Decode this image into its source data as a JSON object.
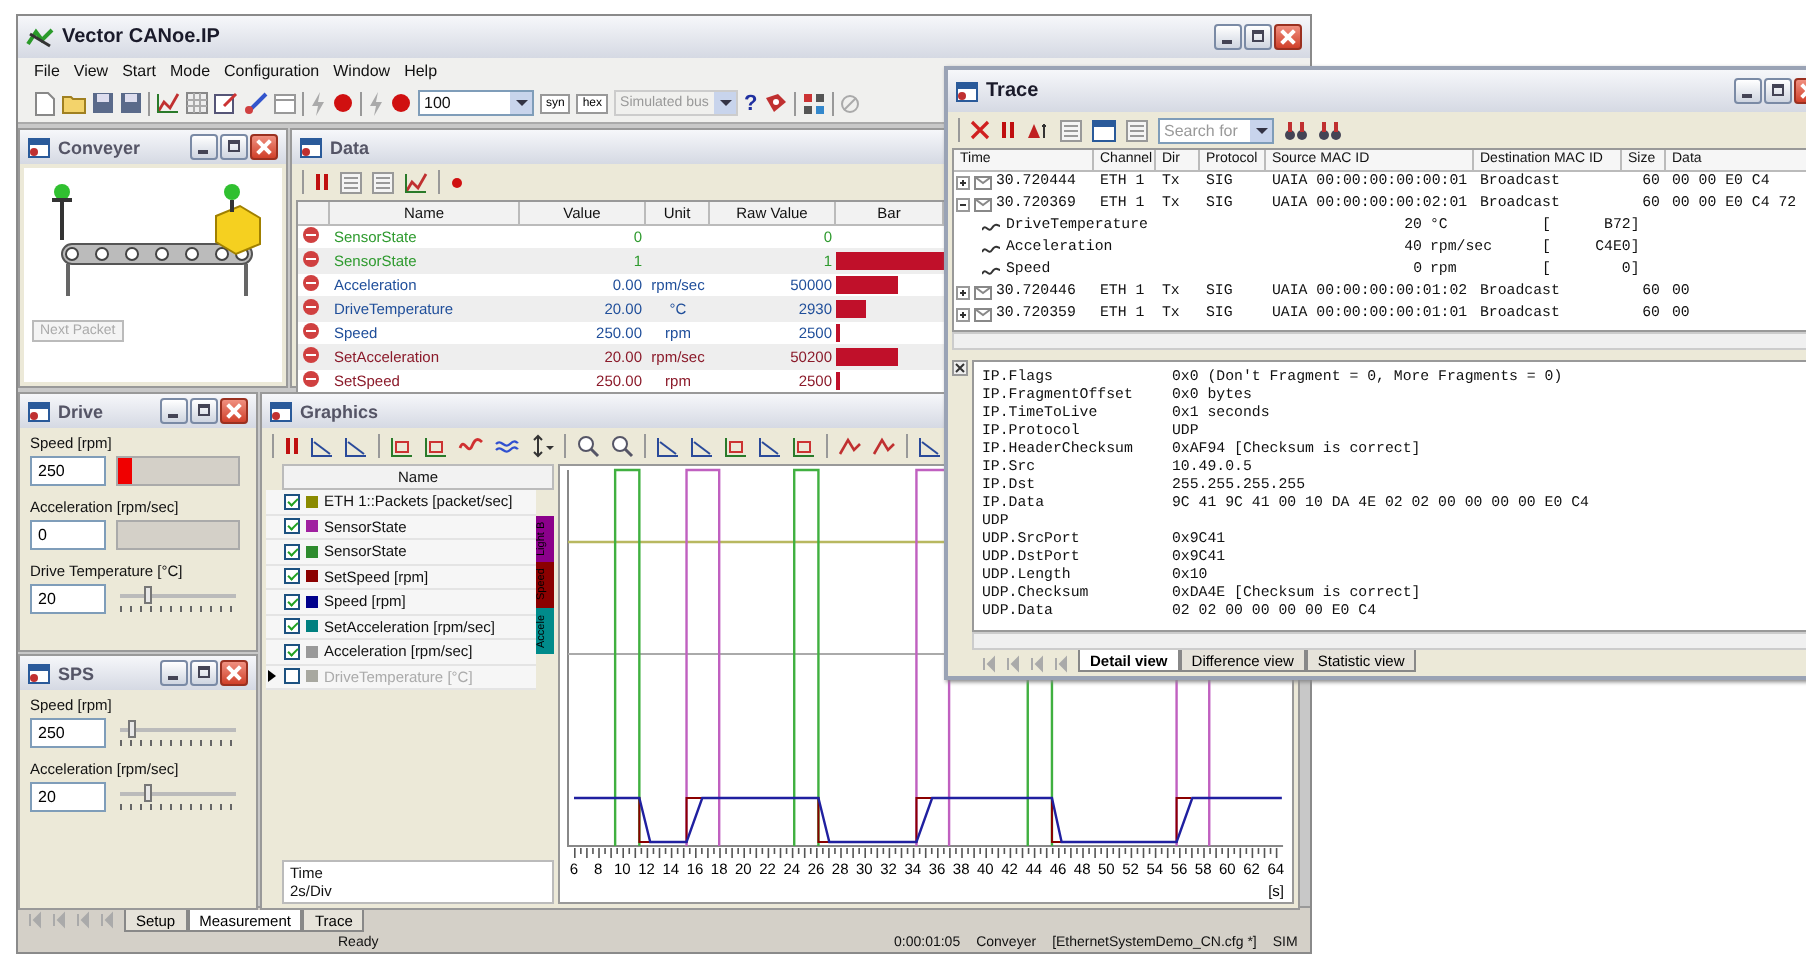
{
  "main_window": {
    "title": "Vector CANoe.IP",
    "menu": [
      "File",
      "View",
      "Start",
      "Mode",
      "Configuration",
      "Window",
      "Help"
    ],
    "toolbar": {
      "zoom_value": "100",
      "buttons": [
        "syn",
        "hex"
      ],
      "bus_select": {
        "value": "Simulated bus",
        "disabled": true
      },
      "help_button": "?"
    }
  },
  "conveyer": {
    "title": "Conveyer",
    "next_button": {
      "label": "Next Packet",
      "disabled": true
    }
  },
  "data": {
    "title": "Data",
    "columns": [
      "Name",
      "Value",
      "Unit",
      "Raw Value",
      "Bar"
    ],
    "rows": [
      {
        "name": "SensorState",
        "value": "0",
        "raw": "0",
        "level": 0,
        "color": "#2e9a2e"
      },
      {
        "name": "SensorState",
        "value": "1",
        "raw": "1",
        "level": 1,
        "color": "#2e9a2e"
      },
      {
        "name": "Acceleration",
        "value": "0.00",
        "unit": "rpm/sec",
        "raw": "50000",
        "level": 0.57,
        "color": "#1f4e9a"
      },
      {
        "name": "DriveTemperature",
        "value": "20.00",
        "unit": "°C",
        "raw": "2930",
        "level": 0.27,
        "color": "#1f4e9a"
      },
      {
        "name": "Speed",
        "value": "250.00",
        "unit": "rpm",
        "raw": "2500",
        "level": 0.04,
        "color": "#1f4e9a"
      },
      {
        "name": "SetAcceleration",
        "value": "20.00",
        "unit": "rpm/sec",
        "raw": "50200",
        "level": 0.57,
        "color": "#8b1a2a"
      },
      {
        "name": "SetSpeed",
        "value": "250.00",
        "unit": "rpm",
        "raw": "2500",
        "level": 0.04,
        "color": "#8b1a2a"
      }
    ]
  },
  "drive": {
    "title": "Drive",
    "controls": [
      {
        "kind": "bar",
        "label": "Speed [rpm]",
        "value": "250",
        "level": 0.12
      },
      {
        "kind": "bar",
        "label": "Acceleration [rpm/sec]",
        "value": "0",
        "level": 0
      },
      {
        "kind": "slider",
        "label": "Drive Temperature [°C]",
        "value": "20",
        "level": 0.25
      }
    ]
  },
  "sps": {
    "title": "SPS",
    "controls": [
      {
        "kind": "slider",
        "label": "Speed [rpm]",
        "value": "250",
        "level": 0.12
      },
      {
        "kind": "slider",
        "label": "Acceleration [rpm/sec]",
        "value": "20",
        "level": 0.25
      }
    ]
  },
  "graphics": {
    "title": "Graphics",
    "list_header": "Name",
    "signals": [
      {
        "name": "ETH 1::Packets [packet/sec]",
        "color": "#8a8a00",
        "checked": true
      },
      {
        "name": "SensorState",
        "color": "#a020a0",
        "checked": true
      },
      {
        "name": "SensorState",
        "color": "#2e8b2e",
        "checked": true
      },
      {
        "name": "SetSpeed [rpm]",
        "color": "#8b0000",
        "checked": true
      },
      {
        "name": "Speed [rpm]",
        "color": "#00008b",
        "checked": true
      },
      {
        "name": "SetAcceleration [rpm/sec]",
        "color": "#008080",
        "checked": true
      },
      {
        "name": "Acceleration [rpm/sec]",
        "color": "#999999",
        "checked": true
      },
      {
        "name": "DriveTemperature [°C]",
        "color": "#a8a8a0",
        "checked": false
      }
    ],
    "axis_tags": [
      {
        "label": "Light B",
        "color": "#8b008b"
      },
      {
        "label": "Speed",
        "color": "#8b0000"
      },
      {
        "label": "Accele",
        "color": "#008b8b"
      }
    ],
    "time_label": "Time",
    "time_div": "2s/Div",
    "x_ticks": [
      "6",
      "8",
      "10",
      "12",
      "14",
      "16",
      "18",
      "20",
      "22",
      "24",
      "26",
      "28",
      "30",
      "32",
      "34",
      "36",
      "38",
      "40",
      "42",
      "44",
      "46",
      "48",
      "50",
      "52",
      "54",
      "56",
      "58",
      "60",
      "62",
      "64"
    ],
    "x_unit": "[s]"
  },
  "page_tabs": [
    {
      "label": "Setup",
      "selected": false
    },
    {
      "label": "Measurement",
      "selected": true
    },
    {
      "label": "Trace",
      "selected": false
    }
  ],
  "status_bar": [
    "Ready",
    "0:00:01:05",
    "Conveyer",
    "[EthernetSystemDemo_CN.cfg *]",
    "SIM"
  ],
  "trace": {
    "title": "Trace",
    "search": {
      "placeholder": "Search for"
    },
    "columns": [
      "Time",
      "Channel",
      "Dir",
      "Protocol",
      "Source MAC ID",
      "Destination MAC ID",
      "Size",
      "Data"
    ],
    "rows": [
      {
        "time": "30.720444",
        "channel": "ETH 1",
        "dir": "Tx",
        "protocol": "SIG",
        "source": "UAIA 00:00:00:00:00:01",
        "destination": "Broadcast",
        "size": "60",
        "data": "00 00 E0 C4",
        "expanded": false
      },
      {
        "time": "30.720369",
        "channel": "ETH 1",
        "dir": "Tx",
        "protocol": "SIG",
        "source": "UAIA 00:00:00:00:02:01",
        "destination": "Broadcast",
        "size": "60",
        "data": "00 00 E0 C4 72",
        "expanded": true,
        "children": [
          {
            "name": "DriveTemperature",
            "value": "20",
            "unit": "°C",
            "raw": "[      B72]"
          },
          {
            "name": "Acceleration",
            "value": "40",
            "unit": "rpm/sec",
            "raw": "[     C4E0]"
          },
          {
            "name": "Speed",
            "value": "0",
            "unit": "rpm",
            "raw": "[        0]"
          }
        ]
      },
      {
        "time": "30.720446",
        "channel": "ETH 1",
        "dir": "Tx",
        "protocol": "SIG",
        "source": "UAIA 00:00:00:00:01:02",
        "destination": "Broadcast",
        "size": "60",
        "data": "00",
        "expanded": false
      },
      {
        "time": "30.720359",
        "channel": "ETH 1",
        "dir": "Tx",
        "protocol": "SIG",
        "source": "UAIA 00:00:00:00:01:01",
        "destination": "Broadcast",
        "size": "60",
        "data": "00",
        "expanded": false
      }
    ],
    "detail": [
      {
        "key": "IP.Flags",
        "value": "0x0 (Don't Fragment = 0, More Fragments = 0)"
      },
      {
        "key": "IP.FragmentOffset",
        "value": "0x0 bytes"
      },
      {
        "key": "IP.TimeToLive",
        "value": "0x1 seconds"
      },
      {
        "key": "IP.Protocol",
        "value": "UDP"
      },
      {
        "key": "IP.HeaderChecksum",
        "value": "0xAF94 [Checksum is correct]"
      },
      {
        "key": "IP.Src",
        "value": "10.49.0.5"
      },
      {
        "key": "IP.Dst",
        "value": "255.255.255.255"
      },
      {
        "key": "IP.Data",
        "value": "9C 41 9C 41 00 10 DA 4E 02 02 00 00 00 00 E0 C4"
      },
      {
        "key": "UDP"
      },
      {
        "key": "UDP.SrcPort",
        "value": "0x9C41"
      },
      {
        "key": "UDP.DstPort",
        "value": "0x9C41"
      },
      {
        "key": "UDP.Length",
        "value": "0x10"
      },
      {
        "key": "UDP.Checksum",
        "value": "0xDA4E [Checksum is correct]"
      },
      {
        "key": "UDP.Data",
        "value": "02 02 00 00 00 00 E0 C4"
      }
    ],
    "tabs": [
      {
        "label": "Detail view",
        "selected": true
      },
      {
        "label": "Difference view",
        "selected": false
      },
      {
        "label": "Statistic view",
        "selected": false
      }
    ]
  }
}
